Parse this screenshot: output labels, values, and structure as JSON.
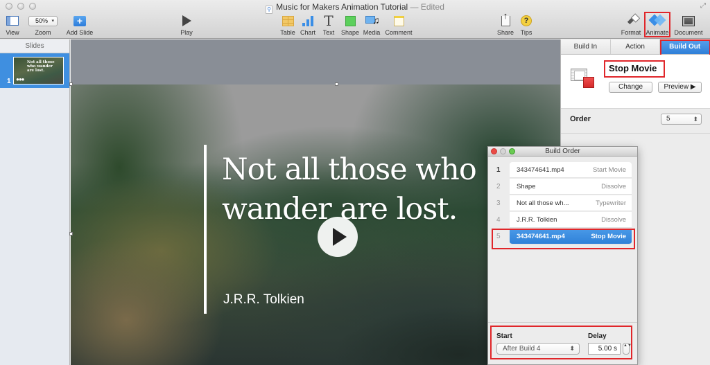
{
  "window": {
    "title": "Music for Makers Animation Tutorial",
    "status": "— Edited"
  },
  "toolbar": {
    "view": "View",
    "zoom": "Zoom",
    "zoom_value": "50%",
    "add_slide": "Add Slide",
    "play": "Play",
    "table": "Table",
    "chart": "Chart",
    "text": "Text",
    "text_glyph": "T",
    "shape": "Shape",
    "media": "Media",
    "media_glyph": "♫",
    "comment": "Comment",
    "share": "Share",
    "tips": "Tips",
    "tips_glyph": "?",
    "format": "Format",
    "animate": "Animate",
    "document": "Document",
    "add_glyph": "+",
    "fullscreen_glyph": "⤢"
  },
  "sidebar": {
    "header": "Slides",
    "slides": [
      {
        "number": "1",
        "thumb_text": "Not all those who wander are lost.",
        "thumb_dots": "●●●"
      }
    ]
  },
  "slide": {
    "quote": "Not all those who wander are lost.",
    "author": "J.R.R. Tolkien"
  },
  "inspector": {
    "tabs": [
      {
        "label": "Build In",
        "active": false
      },
      {
        "label": "Action",
        "active": false
      },
      {
        "label": "Build Out",
        "active": true
      }
    ],
    "effect_name": "Stop Movie",
    "change_button": "Change",
    "preview_button": "Preview ▶",
    "order_label": "Order",
    "order_value": "5"
  },
  "build_order": {
    "title": "Build Order",
    "items": [
      {
        "number": "1",
        "name": "343474641.mp4",
        "effect": "Start Movie",
        "selected": false
      },
      {
        "number": "2",
        "name": "Shape",
        "effect": "Dissolve",
        "selected": false
      },
      {
        "number": "3",
        "name": "Not all those wh...",
        "effect": "Typewriter",
        "selected": false
      },
      {
        "number": "4",
        "name": "J.R.R. Tolkien",
        "effect": "Dissolve",
        "selected": false
      },
      {
        "number": "5",
        "name": "343474641.mp4",
        "effect": "Stop Movie",
        "selected": true
      }
    ],
    "start_label": "Start",
    "start_value": "After Build 4",
    "delay_label": "Delay",
    "delay_value": "5.00 s",
    "stepper_glyph": "▲▼"
  },
  "colors": {
    "accent_blue": "#2f7fd8",
    "annotation_red": "#e0262a"
  }
}
